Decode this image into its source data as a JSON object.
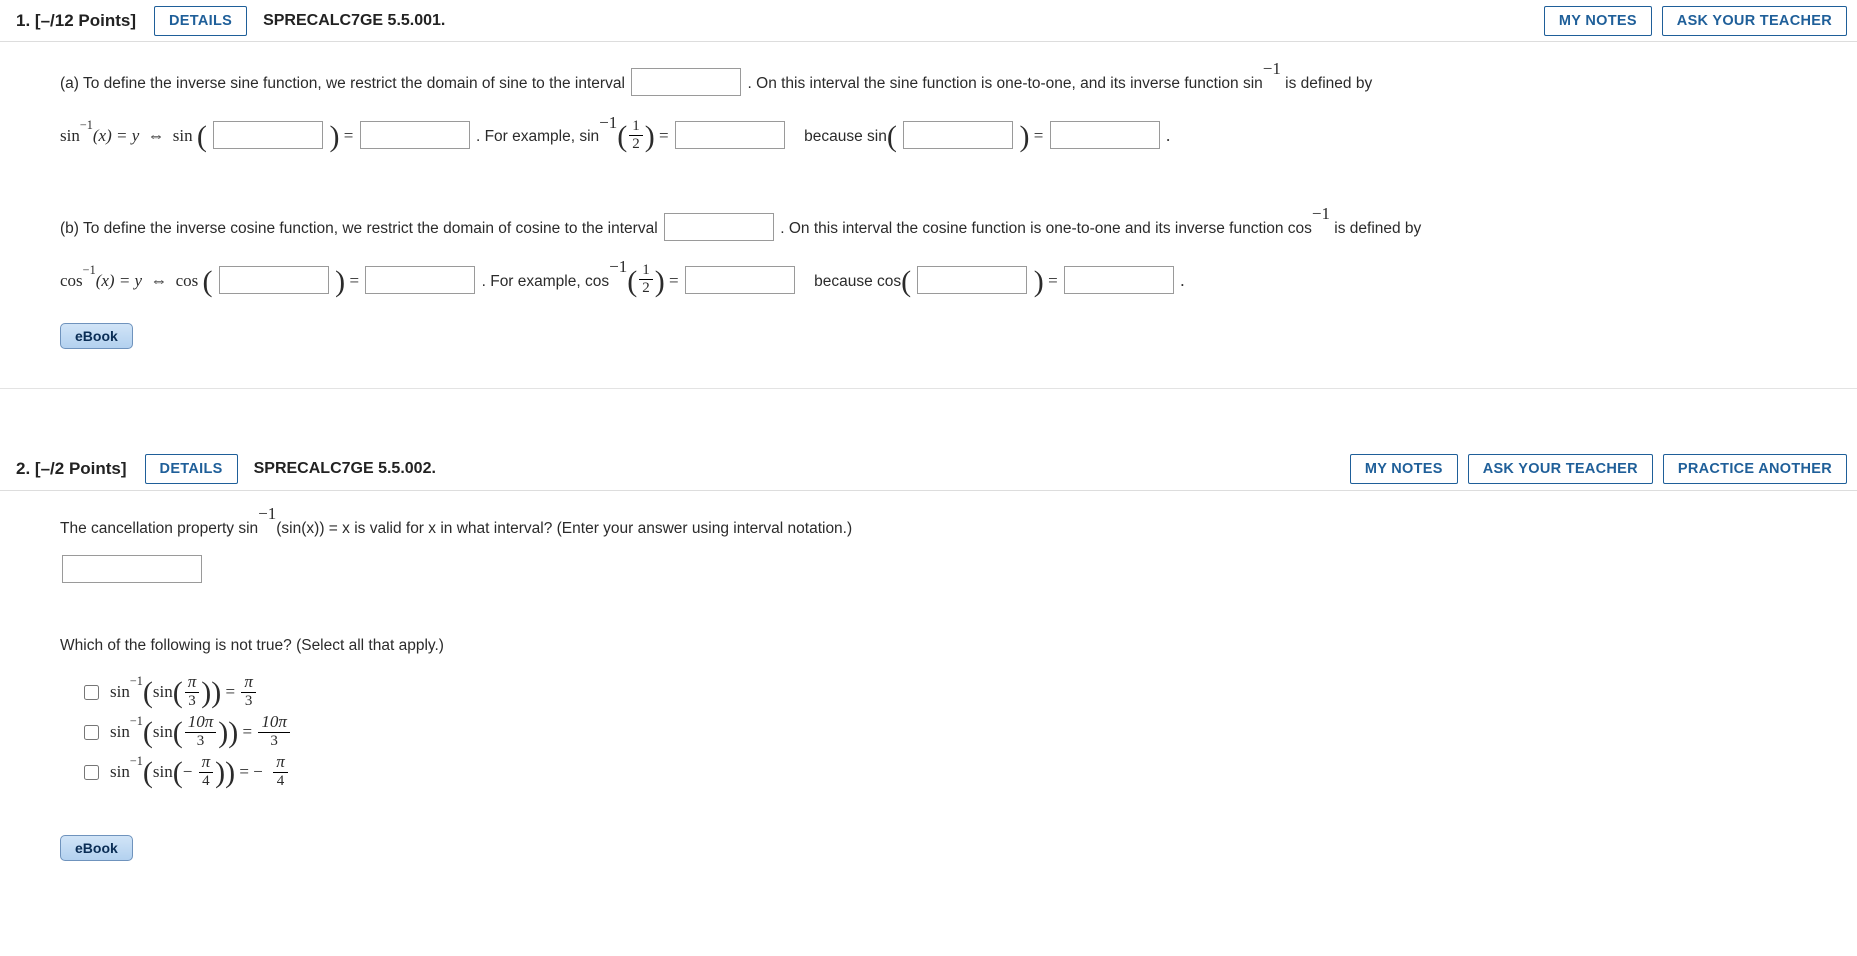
{
  "buttons": {
    "details": "DETAILS",
    "my_notes": "MY NOTES",
    "ask_teacher": "ASK YOUR TEACHER",
    "practice_another": "PRACTICE ANOTHER",
    "ebook": "eBook"
  },
  "q1": {
    "number": "1.",
    "points": "[–/12 Points]",
    "ref": "SPRECALC7GE 5.5.001.",
    "a": {
      "lead": "(a) To define the inverse sine function, we restrict the domain of sine to the interval ",
      "after_interval": ". On this interval the sine function is one-to-one, and its inverse function  sin",
      "defined_by": "  is defined by",
      "line2_pre": "sin",
      "line2_mid": "(x) = y ",
      "line2_sin": " sin",
      "line2_eq": " = ",
      "for_example": ". For example,  sin",
      "because": "because  sin",
      "eq2": " = "
    },
    "b": {
      "lead": "(b) To define the inverse cosine function, we restrict the domain of cosine to the interval ",
      "after_interval": ". On this interval the cosine function is one-to-one and its inverse function  cos",
      "defined_by": "  is defined by",
      "line2_pre": "cos",
      "line2_mid": "(x) = y ",
      "line2_cos": " cos",
      "line2_eq": " = ",
      "for_example": ". For example,  cos",
      "because": "because  cos",
      "eq2": " = "
    }
  },
  "q2": {
    "number": "2.",
    "points": "[–/2 Points]",
    "ref": "SPRECALC7GE 5.5.002.",
    "prompt_a": "The cancellation property  sin",
    "prompt_b": "(sin(x)) = x  is valid for x in what interval? (Enter your answer using interval notation.)",
    "which": "Which of the following is not true? (Select all that apply.)",
    "opts": {
      "a": {
        "inner_num": "π",
        "inner_den": "3",
        "rhs_num": "π",
        "rhs_den": "3"
      },
      "b": {
        "inner_num": "10π",
        "inner_den": "3",
        "rhs_num": "10π",
        "rhs_den": "3"
      },
      "c": {
        "inner_num": "π",
        "inner_den": "4",
        "rhs_num": "π",
        "rhs_den": "4"
      }
    }
  },
  "chart_data": {
    "type": "table",
    "description": "Math homework page with two questions on inverse trig functions; fill-in blanks and multiple-select checkboxes.",
    "questions": [
      {
        "id": 1,
        "points_possible": 12,
        "source": "SPRECALC7GE 5.5.001.",
        "parts": [
          "(a) inverse sine definition blanks",
          "(b) inverse cosine definition blanks"
        ]
      },
      {
        "id": 2,
        "points_possible": 2,
        "source": "SPRECALC7GE 5.5.002.",
        "parts": [
          "interval for cancellation of sin^-1(sin x)",
          "select-all sin^-1(sin(...)) identities"
        ]
      }
    ]
  }
}
